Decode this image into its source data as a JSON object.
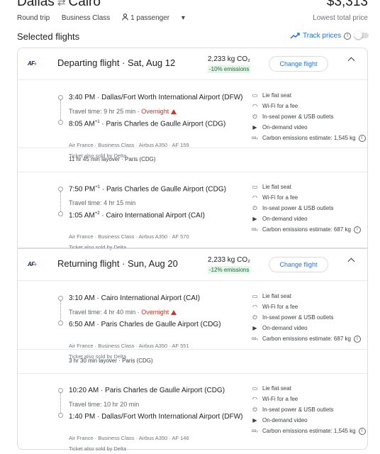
{
  "header": {
    "origin": "Dallas",
    "destination": "Cairo",
    "swap_icon": "⇄",
    "price": "$3,313",
    "trip_type": "Round trip",
    "cabin": "Business Class",
    "passengers": "1 passenger",
    "price_label": "Lowest total price"
  },
  "selected_title": "Selected flights",
  "track_label": "Track prices",
  "cards": [
    {
      "title": "Departing flight",
      "date": "Sat, Aug 12",
      "co2": "2,233 kg CO₂",
      "emissions": "-10% emissions",
      "change": "Change flight",
      "legs": [
        {
          "dep_time": "3:40 PM",
          "dep_airport": "Dallas/Fort Worth International Airport (DFW)",
          "travel_time": "Travel time: 9 hr 25 min",
          "overnight": "Overnight",
          "arr_time": "8:05 AM",
          "arr_sup": "+1",
          "arr_airport": "Paris Charles de Gaulle Airport (CDG)",
          "meta": "Air France · Business Class · Airbus A350 · AF 159",
          "sold": "Ticket also sold by Delta",
          "amen": [
            "Lie flat seat",
            "Wi-Fi for a fee",
            "In-seat power & USB outlets",
            "On-demand video",
            "Carbon emissions estimate: 1,545 kg"
          ]
        },
        {
          "dep_time": "7:50 PM",
          "dep_sup": "+1",
          "dep_airport": "Paris Charles de Gaulle Airport (CDG)",
          "travel_time": "Travel time: 4 hr 15 min",
          "arr_time": "1:05 AM",
          "arr_sup": "+2",
          "arr_airport": "Cairo International Airport (CAI)",
          "meta": "Air France · Business Class · Airbus A350 · AF 570",
          "sold": "Ticket also sold by Delta",
          "amen": [
            "Lie flat seat",
            "Wi-Fi for a fee",
            "In-seat power & USB outlets",
            "On-demand video",
            "Carbon emissions estimate: 687 kg"
          ]
        }
      ],
      "layover": "11 hr 45 min layover · Paris (CDG)"
    },
    {
      "title": "Returning flight",
      "date": "Sun, Aug 20",
      "co2": "2,233 kg CO₂",
      "emissions": "-12% emissions",
      "change": "Change flight",
      "legs": [
        {
          "dep_time": "3:10 AM",
          "dep_airport": "Cairo International Airport (CAI)",
          "travel_time": "Travel time: 4 hr 40 min",
          "overnight": "Overnight",
          "arr_time": "6:50 AM",
          "arr_airport": "Paris Charles de Gaulle Airport (CDG)",
          "meta": "Air France · Business Class · Airbus A350 · AF 551",
          "sold": "Ticket also sold by Delta",
          "amen": [
            "Lie flat seat",
            "Wi-Fi for a fee",
            "In-seat power & USB outlets",
            "On-demand video",
            "Carbon emissions estimate: 687 kg"
          ]
        },
        {
          "dep_time": "10:20 AM",
          "dep_airport": "Paris Charles de Gaulle Airport (CDG)",
          "travel_time": "Travel time: 10 hr 20 min",
          "arr_time": "1:40 PM",
          "arr_airport": "Dallas/Fort Worth International Airport (DFW)",
          "meta": "Air France · Business Class · Airbus A350 · AF 146",
          "sold": "Ticket also sold by Delta",
          "amen": [
            "Lie flat seat",
            "Wi-Fi for a fee",
            "In-seat power & USB outlets",
            "On-demand video",
            "Carbon emissions estimate: 1,545 kg"
          ]
        }
      ],
      "layover": "3 hr 30 min layover · Paris (CDG)"
    }
  ],
  "airline_logo": "AF"
}
